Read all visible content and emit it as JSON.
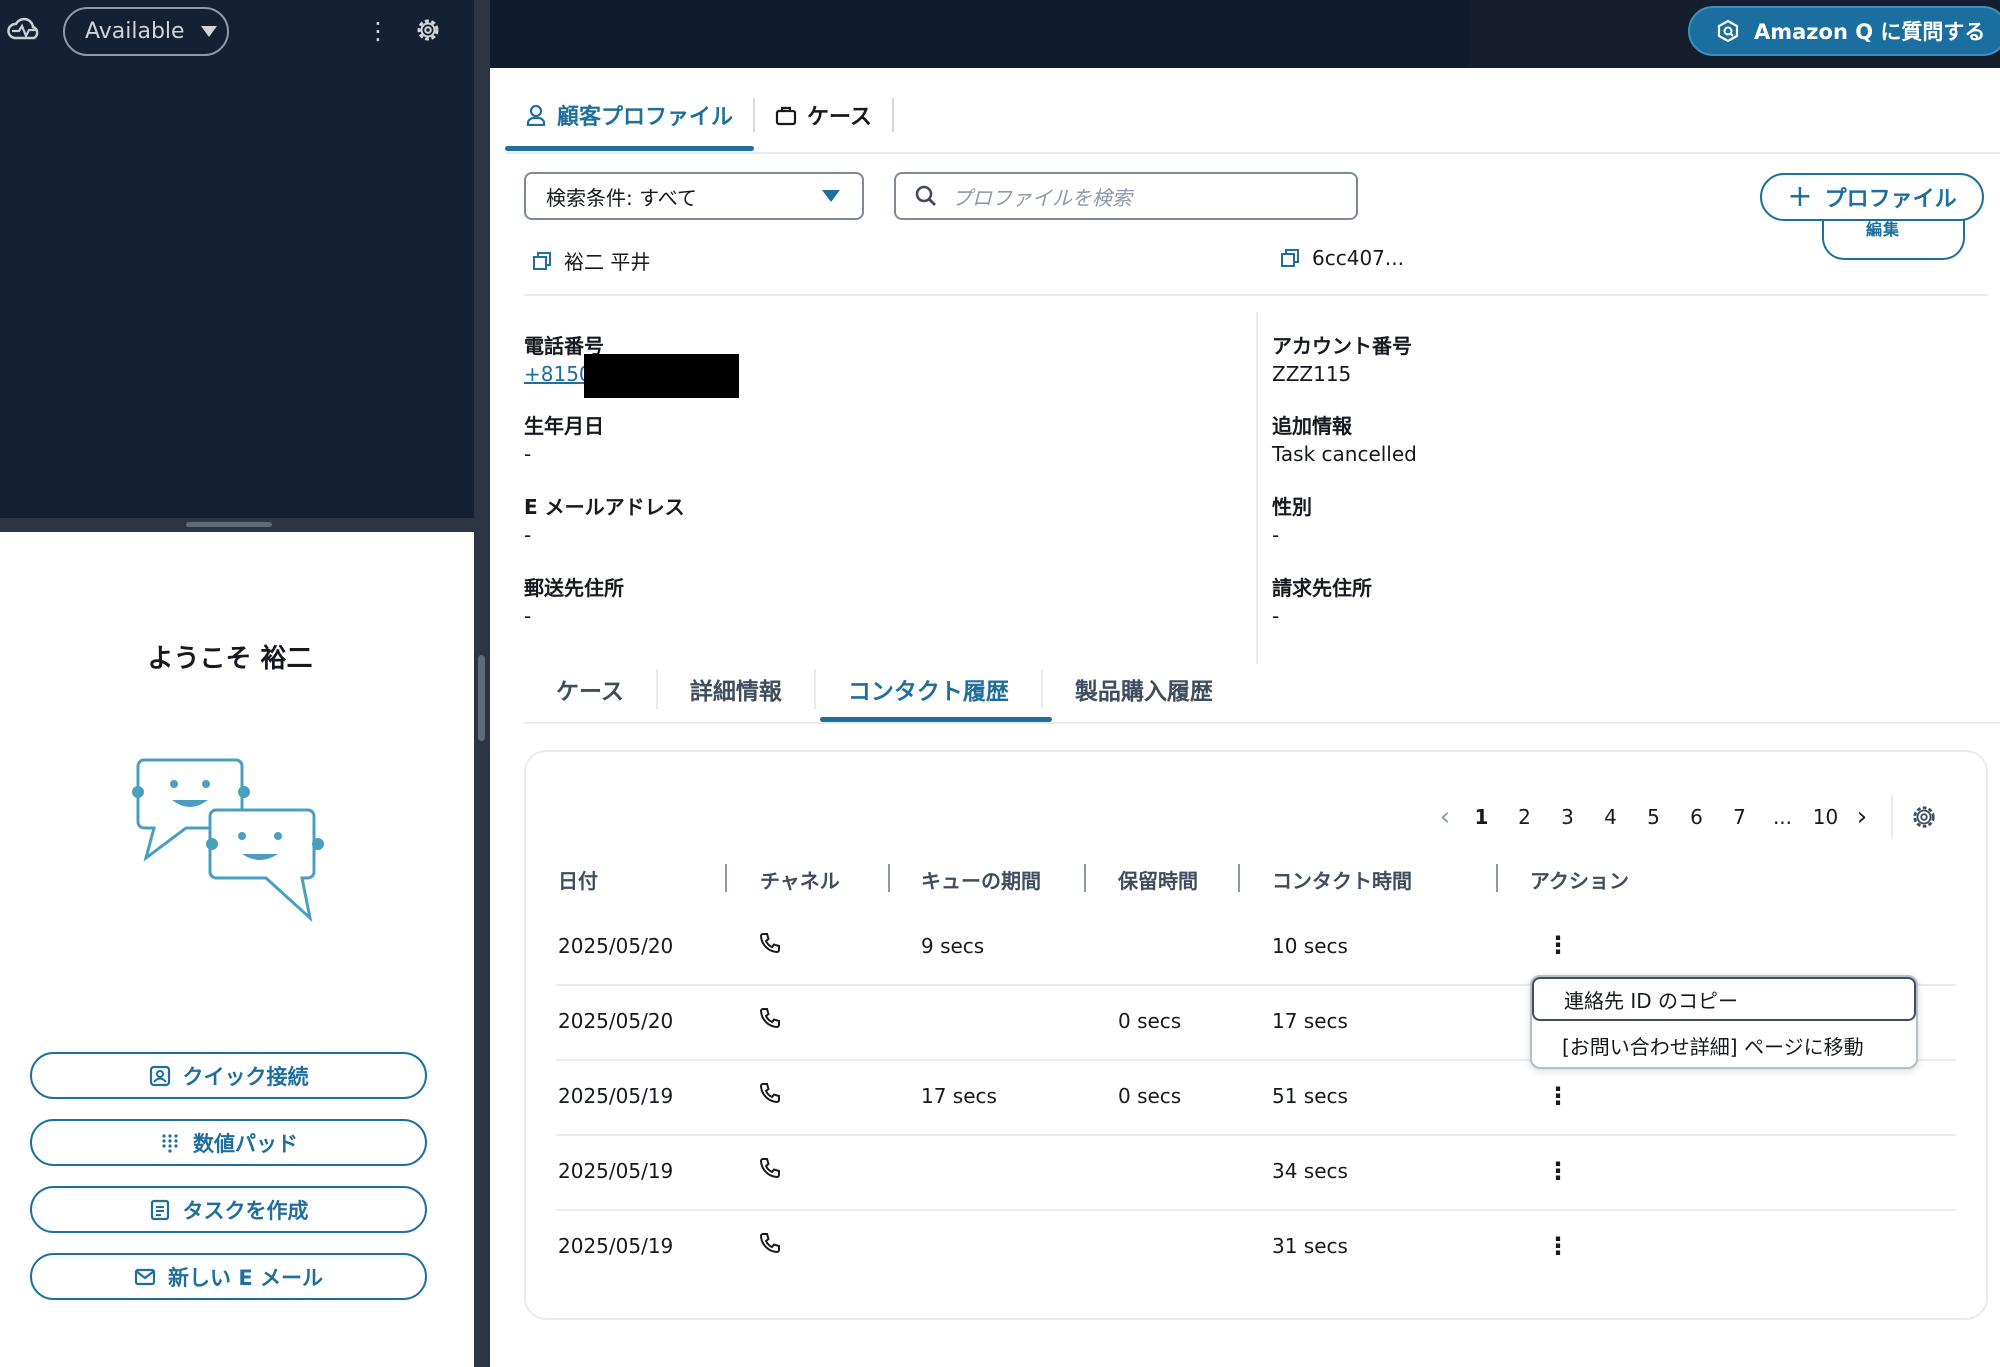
{
  "ccp": {
    "status": "Available",
    "welcome": "ようこそ 裕二",
    "quick_buttons": [
      "クイック接続",
      "数値パッド",
      "タスクを作成",
      "新しい E メール"
    ]
  },
  "topbar": {
    "amazon_q_label": "Amazon Q に質問する"
  },
  "top_tabs": [
    "顧客プロファイル",
    "ケース"
  ],
  "search": {
    "filter_label": "検索条件: すべて",
    "placeholder": "プロファイルを検索",
    "add_profile_label": "プロファイル",
    "edit_label": "編集"
  },
  "profile": {
    "name": "裕二 平井",
    "profile_id": "6cc407...",
    "left_fields": [
      {
        "label": "電話番号",
        "value": "+8150"
      },
      {
        "label": "生年月日",
        "value": "-"
      },
      {
        "label": "E メールアドレス",
        "value": "-"
      },
      {
        "label": "郵送先住所",
        "value": "-"
      }
    ],
    "right_fields": [
      {
        "label": "アカウント番号",
        "value": "ZZZ115"
      },
      {
        "label": "追加情報",
        "value": "Task cancelled"
      },
      {
        "label": "性別",
        "value": "-"
      },
      {
        "label": "請求先住所",
        "value": "-"
      }
    ]
  },
  "sub_tabs": [
    "ケース",
    "詳細情報",
    "コンタクト履歴",
    "製品購入履歴"
  ],
  "pager": {
    "pages": [
      "1",
      "2",
      "3",
      "4",
      "5",
      "6",
      "7",
      "...",
      "10"
    ],
    "current": "1"
  },
  "table": {
    "headers": [
      "日付",
      "チャネル",
      "キューの期間",
      "保留時間",
      "コンタクト時間",
      "アクション"
    ],
    "rows": [
      {
        "date": "2025/05/20",
        "channel": "phone-icon",
        "queue": "9 secs",
        "hold": "",
        "contact": "10 secs"
      },
      {
        "date": "2025/05/20",
        "channel": "phone-icon",
        "queue": "",
        "hold": "0 secs",
        "contact": "17 secs"
      },
      {
        "date": "2025/05/19",
        "channel": "phone-icon",
        "queue": "17 secs",
        "hold": "0 secs",
        "contact": "51 secs"
      },
      {
        "date": "2025/05/19",
        "channel": "phone-icon",
        "queue": "",
        "hold": "",
        "contact": "34 secs"
      },
      {
        "date": "2025/05/19",
        "channel": "phone-icon",
        "queue": "",
        "hold": "",
        "contact": "31 secs"
      }
    ]
  },
  "action_menu": [
    "連絡先 ID のコピー",
    "[お問い合わせ詳細] ページに移動"
  ],
  "colors": {
    "accent": "#1f6f9c",
    "dark_bg": "#152034",
    "topbar_bg": "#0f1b2d"
  }
}
